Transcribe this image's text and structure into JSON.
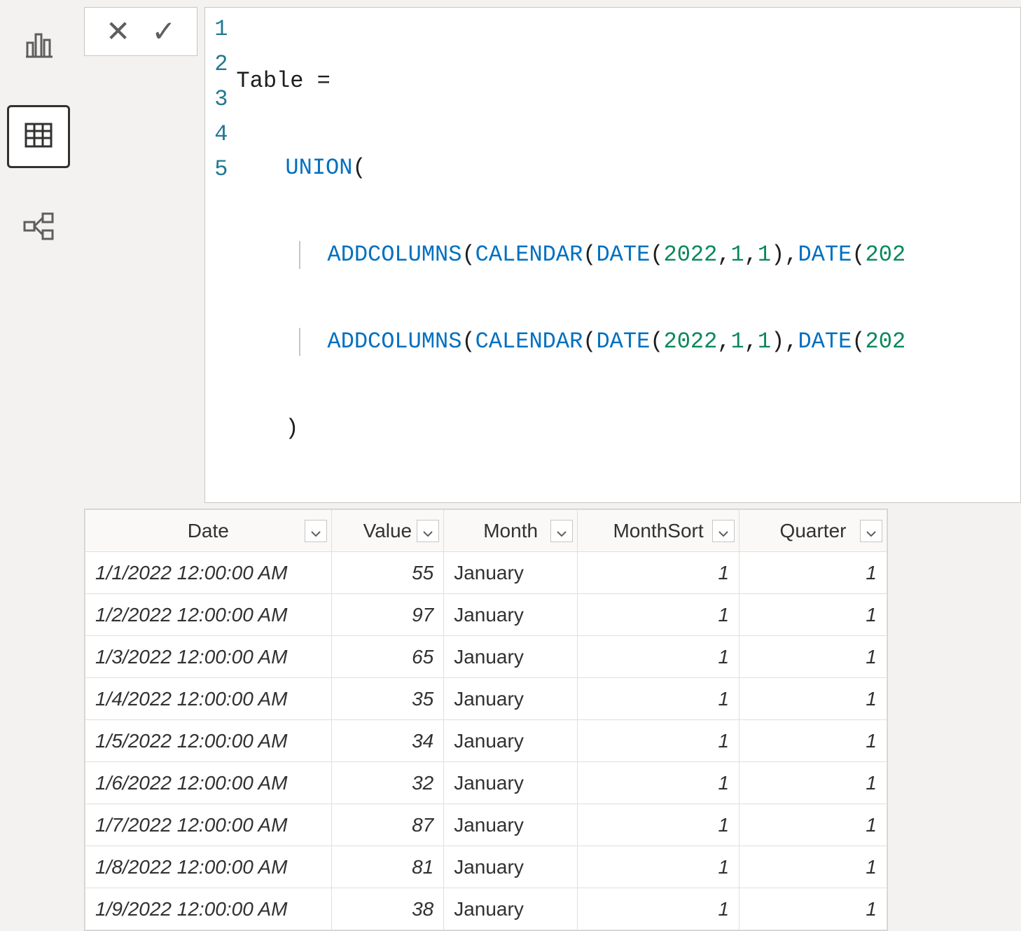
{
  "nav": {
    "report_tooltip": "Report",
    "data_tooltip": "Data",
    "model_tooltip": "Model"
  },
  "formula_bar": {
    "cancel_glyph": "✕",
    "commit_glyph": "✓",
    "lines": {
      "l1": "Table =",
      "l2_fn": "UNION",
      "l2_rest": "(",
      "l3_a": "ADDCOLUMNS",
      "l3_b": "CALENDAR",
      "l3_c": "DATE",
      "l3_n1": "2022",
      "l3_n2": "1",
      "l3_n3": "1",
      "l3_d": "DATE",
      "l3_n4": "202",
      "l4_a": "ADDCOLUMNS",
      "l4_b": "CALENDAR",
      "l4_c": "DATE",
      "l4_n1": "2022",
      "l4_n2": "1",
      "l4_n3": "1",
      "l4_d": "DATE",
      "l4_n4": "202",
      "l5": ")"
    },
    "gutter": [
      "1",
      "2",
      "3",
      "4",
      "5"
    ]
  },
  "table": {
    "columns": [
      "Date",
      "Value",
      "Month",
      "MonthSort",
      "Quarter"
    ],
    "rows": [
      {
        "date": "1/1/2022 12:00:00 AM",
        "value": "55",
        "month": "January",
        "monthsort": "1",
        "quarter": "1"
      },
      {
        "date": "1/2/2022 12:00:00 AM",
        "value": "97",
        "month": "January",
        "monthsort": "1",
        "quarter": "1"
      },
      {
        "date": "1/3/2022 12:00:00 AM",
        "value": "65",
        "month": "January",
        "monthsort": "1",
        "quarter": "1"
      },
      {
        "date": "1/4/2022 12:00:00 AM",
        "value": "35",
        "month": "January",
        "monthsort": "1",
        "quarter": "1"
      },
      {
        "date": "1/5/2022 12:00:00 AM",
        "value": "34",
        "month": "January",
        "monthsort": "1",
        "quarter": "1"
      },
      {
        "date": "1/6/2022 12:00:00 AM",
        "value": "32",
        "month": "January",
        "monthsort": "1",
        "quarter": "1"
      },
      {
        "date": "1/7/2022 12:00:00 AM",
        "value": "87",
        "month": "January",
        "monthsort": "1",
        "quarter": "1"
      },
      {
        "date": "1/8/2022 12:00:00 AM",
        "value": "81",
        "month": "January",
        "monthsort": "1",
        "quarter": "1"
      },
      {
        "date": "1/9/2022 12:00:00 AM",
        "value": "38",
        "month": "January",
        "monthsort": "1",
        "quarter": "1"
      }
    ]
  }
}
